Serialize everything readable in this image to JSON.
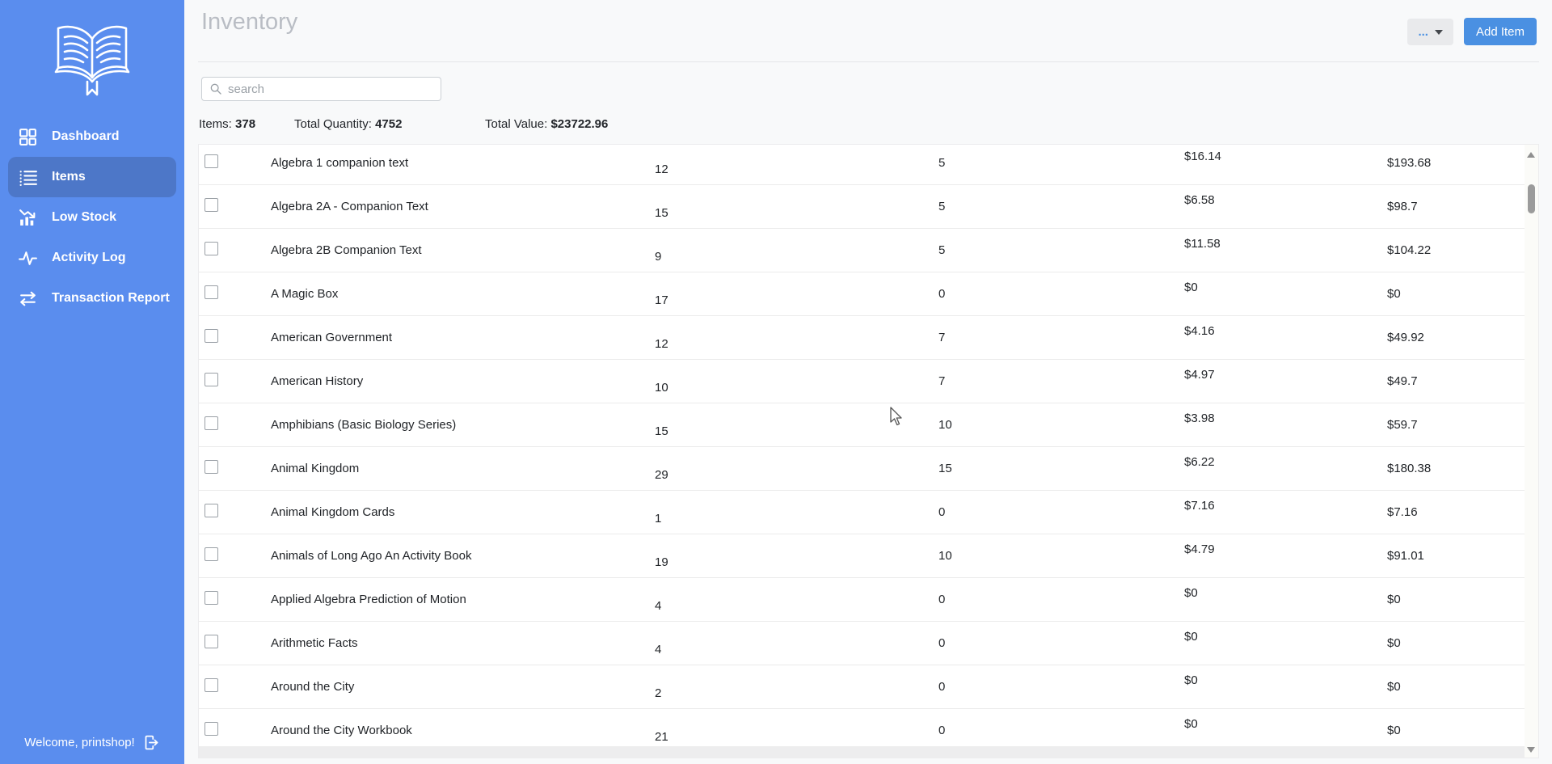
{
  "colors": {
    "sidebar": "#5a8dee",
    "sidebar_active": "#4d77c8",
    "primary": "#4a90e2",
    "page_bg": "#f8f9fa",
    "title": "#b9bdc4"
  },
  "sidebar": {
    "logo_icon": "open-book-logo",
    "items": [
      {
        "label": "Dashboard",
        "icon": "dashboard",
        "active": false
      },
      {
        "label": "Items",
        "icon": "list",
        "active": true
      },
      {
        "label": "Low Stock",
        "icon": "low-stock",
        "active": false
      },
      {
        "label": "Activity Log",
        "icon": "activity",
        "active": false
      },
      {
        "label": "Transaction Report",
        "icon": "transfer",
        "active": false
      }
    ],
    "welcome_text": "Welcome, printshop!"
  },
  "header": {
    "title": "Inventory",
    "more_button_label": "...",
    "add_item_label": "Add Item"
  },
  "toolbar": {
    "search_placeholder": "search",
    "stats": [
      {
        "label": "Items:",
        "value": "378"
      },
      {
        "label": "Total Quantity:",
        "value": "4752"
      },
      {
        "label": "Total Value:",
        "value": "$23722.96"
      }
    ]
  },
  "table": {
    "rows": [
      {
        "name": "Algebra 1 companion text",
        "quantity": "12",
        "threshold": "5",
        "price": "$16.14",
        "total": "$193.68"
      },
      {
        "name": "Algebra 2A - Companion Text",
        "quantity": "15",
        "threshold": "5",
        "price": "$6.58",
        "total": "$98.7"
      },
      {
        "name": "Algebra 2B Companion Text",
        "quantity": "9",
        "threshold": "5",
        "price": "$11.58",
        "total": "$104.22"
      },
      {
        "name": "A Magic Box",
        "quantity": "17",
        "threshold": "0",
        "price": "$0",
        "total": "$0"
      },
      {
        "name": "American Government",
        "quantity": "12",
        "threshold": "7",
        "price": "$4.16",
        "total": "$49.92"
      },
      {
        "name": "American History",
        "quantity": "10",
        "threshold": "7",
        "price": "$4.97",
        "total": "$49.7"
      },
      {
        "name": "Amphibians (Basic Biology Series)",
        "quantity": "15",
        "threshold": "10",
        "price": "$3.98",
        "total": "$59.7"
      },
      {
        "name": "Animal Kingdom",
        "quantity": "29",
        "threshold": "15",
        "price": "$6.22",
        "total": "$180.38"
      },
      {
        "name": "Animal Kingdom Cards",
        "quantity": "1",
        "threshold": "0",
        "price": "$7.16",
        "total": "$7.16"
      },
      {
        "name": "Animals of Long Ago An Activity Book",
        "quantity": "19",
        "threshold": "10",
        "price": "$4.79",
        "total": "$91.01"
      },
      {
        "name": "Applied Algebra Prediction of Motion",
        "quantity": "4",
        "threshold": "0",
        "price": "$0",
        "total": "$0"
      },
      {
        "name": "Arithmetic Facts",
        "quantity": "4",
        "threshold": "0",
        "price": "$0",
        "total": "$0"
      },
      {
        "name": "Around the City",
        "quantity": "2",
        "threshold": "0",
        "price": "$0",
        "total": "$0"
      },
      {
        "name": "Around the City Workbook",
        "quantity": "21",
        "threshold": "0",
        "price": "$0",
        "total": "$0"
      }
    ]
  }
}
